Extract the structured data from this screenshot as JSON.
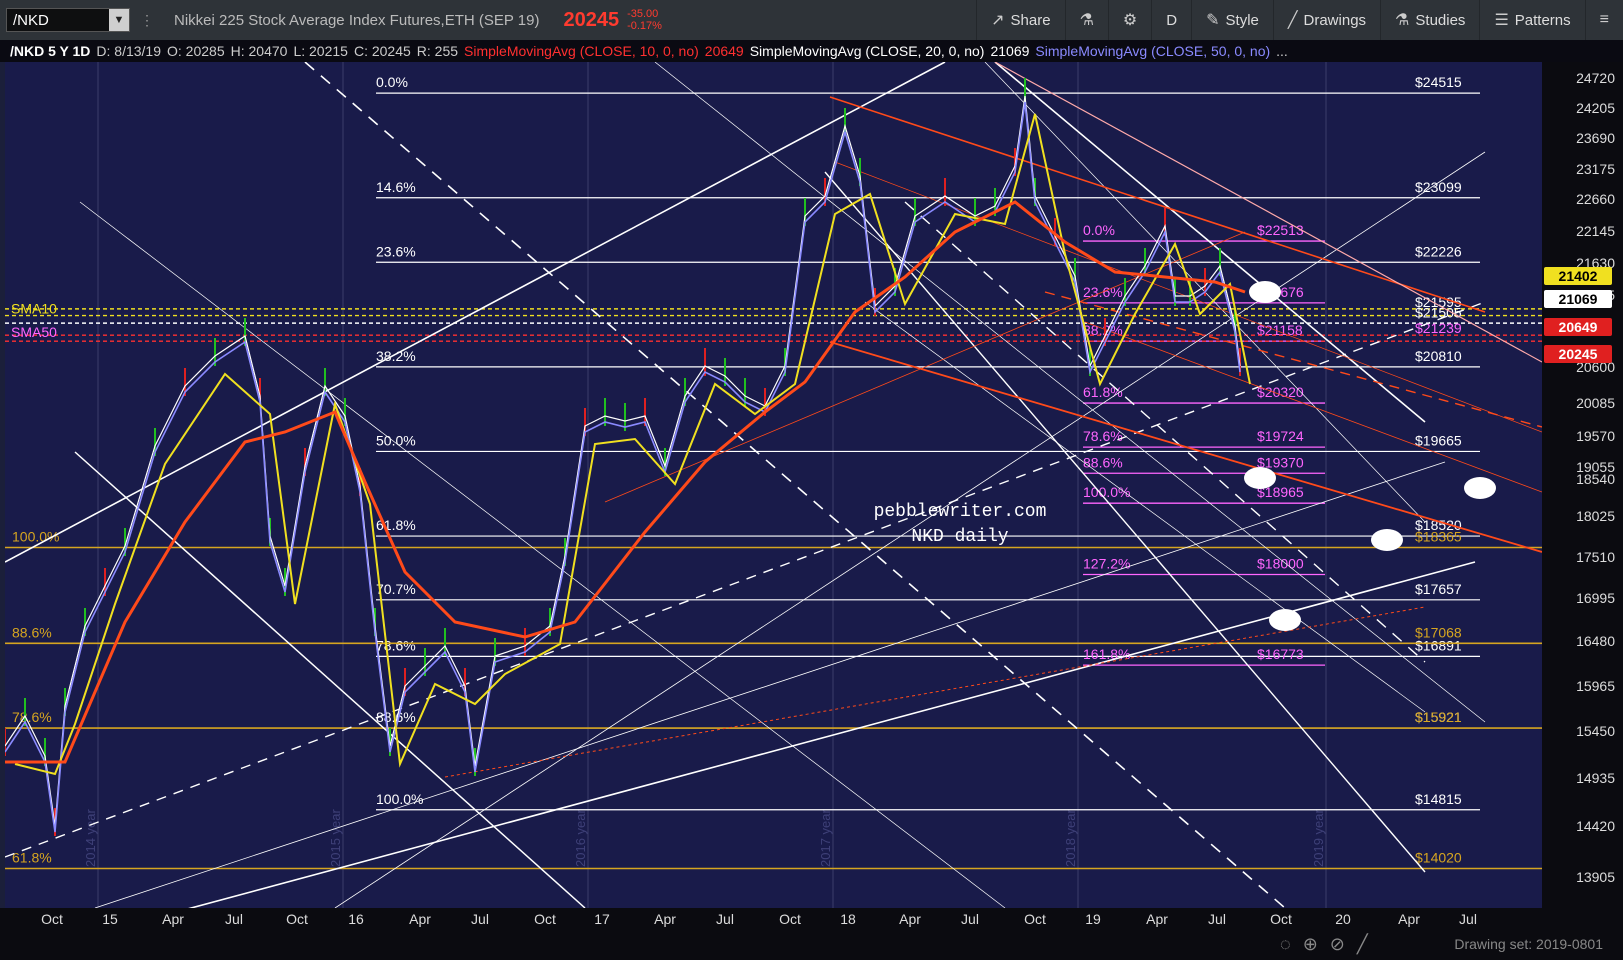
{
  "toolbar": {
    "symbol": "/NKD",
    "description": "Nikkei 225 Stock Average Index Futures,ETH (SEP 19)",
    "last_price": "20245",
    "change": "-35.00",
    "change_pct": "-0.17%",
    "share_label": "Share",
    "period_label": "D",
    "style_label": "Style",
    "drawings_label": "Drawings",
    "studies_label": "Studies",
    "patterns_label": "Patterns"
  },
  "study_bar": {
    "symbol_period": "/NKD 5 Y 1D",
    "date": "D: 8/13/19",
    "open": "O: 20285",
    "high": "H: 20470",
    "low": "L: 20215",
    "close": "C: 20245",
    "range": "R: 255",
    "sma10_label": "SimpleMovingAvg (CLOSE, 10, 0, no)",
    "sma10_value": "20649",
    "sma20_label": "SimpleMovingAvg (CLOSE, 20, 0, no)",
    "sma20_value": "21069",
    "sma50_label": "SimpleMovingAvg (CLOSE, 50, 0, no)",
    "more": "..."
  },
  "price_axis": [
    "24720",
    "24205",
    "23690",
    "23175",
    "22660",
    "22145",
    "21630",
    "21115",
    "20600",
    "20085",
    "19570",
    "19055",
    "18540",
    "18025",
    "17510",
    "16995",
    "16480",
    "15965",
    "15450",
    "14935",
    "14420",
    "13905"
  ],
  "price_tags": [
    {
      "text": "21402",
      "color": "#f0e020",
      "fg": "#000"
    },
    {
      "text": "21069",
      "color": "#ffffff",
      "fg": "#000"
    },
    {
      "text": "20649",
      "color": "#e02020",
      "fg": "#fff"
    },
    {
      "text": "20245",
      "color": "#e02020",
      "fg": "#fff"
    }
  ],
  "x_axis": [
    "Oct",
    "15",
    "Apr",
    "Jul",
    "Oct",
    "16",
    "Apr",
    "Jul",
    "Oct",
    "17",
    "Apr",
    "Jul",
    "Oct",
    "18",
    "Apr",
    "Jul",
    "Oct",
    "19",
    "Apr",
    "Jul",
    "Oct",
    "20",
    "Apr",
    "Jul"
  ],
  "year_labels": [
    "2014 year",
    "2015 year",
    "2016 year",
    "2017 year",
    "2018 year",
    "2019 year"
  ],
  "watermark": {
    "line1": "pebblewriter.com",
    "line2": "NKD daily"
  },
  "sma_left_labels": {
    "sma10": "SMA10",
    "sma50": "SMA50",
    "sma20": "SMA20"
  },
  "fib_large": [
    "0.0%",
    "14.6%",
    "23.6%",
    "38.2%",
    "50.0%",
    "61.8%",
    "70.7%",
    "78.6%",
    "88.6%",
    "100.0%"
  ],
  "fib_large_prices": [
    "$24515",
    "$23099",
    "$22226",
    "$20810",
    "$19665",
    "$18520",
    "$17657",
    "$16891",
    "$15921",
    "$14815"
  ],
  "fib_small": [
    "0.0%",
    "23.6%",
    "38.2%",
    "61.8%",
    "78.6%",
    "88.6%",
    "100.0%",
    "127.2%",
    "161.8%"
  ],
  "fib_small_prices": [
    "$22513",
    "$21676",
    "$21158",
    "$20320",
    "$19724",
    "$19370",
    "$18965",
    "$18000",
    "$16773"
  ],
  "fib_gold": [
    "100.0%",
    "88.6%",
    "78.6%",
    "61.8%"
  ],
  "fib_gold_prices": [
    "$18365",
    "$17068",
    "$15921",
    "$14020"
  ],
  "top_prices": {
    "a": "$21595",
    "b": "$21505",
    "c": "$21239"
  },
  "status": {
    "drawing_set": "Drawing set: 2019-0801"
  },
  "colors": {
    "bg": "#191b4a",
    "sma10": "#ffffff",
    "sma20": "#f0e020",
    "sma50": "#8a8aff",
    "sma_long": "#ff4a1a",
    "fib_small": "#ff66ff",
    "fib_gold": "#d6a520",
    "up": "#20c020",
    "down": "#e02020"
  }
}
